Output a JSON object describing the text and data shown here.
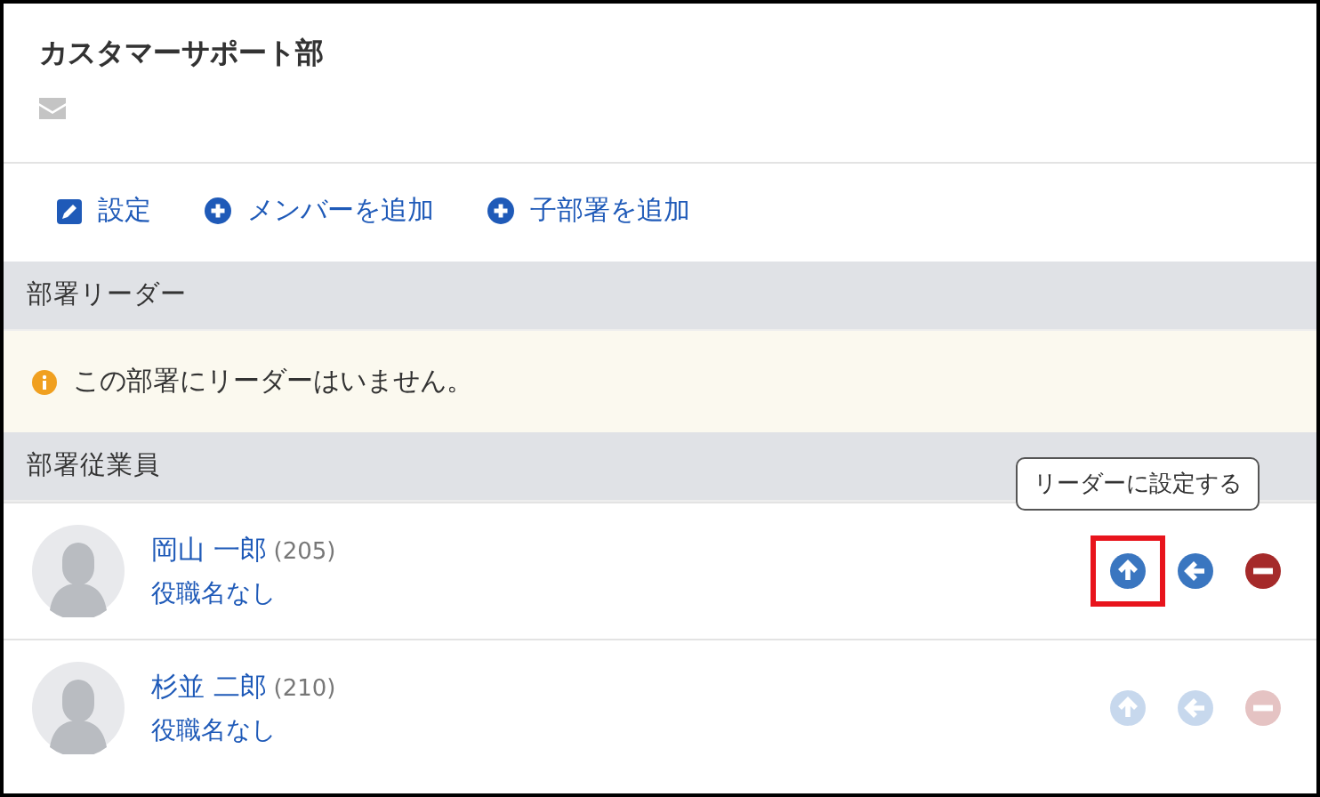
{
  "department": {
    "title": "カスタマーサポート部"
  },
  "toolbar": [
    {
      "kind": "edit",
      "label": "設定"
    },
    {
      "kind": "add",
      "label": "メンバーを追加"
    },
    {
      "kind": "add",
      "label": "子部署を追加"
    }
  ],
  "leader_section": {
    "heading": "部署リーダー",
    "notice": "この部署にリーダーはいません。"
  },
  "members_section": {
    "heading": "部署従業員",
    "members": [
      {
        "name": "岡山 一郎",
        "number": "(205)",
        "position": "役職名なし",
        "active": true,
        "tooltip": "リーダーに設定する",
        "actions": [
          {
            "kind": "promote",
            "highlighted": true
          },
          {
            "kind": "move",
            "highlighted": false
          },
          {
            "kind": "remove",
            "highlighted": false
          }
        ]
      },
      {
        "name": "杉並 二郎",
        "number": "(210)",
        "position": "役職名なし",
        "active": false,
        "actions": [
          {
            "kind": "promote",
            "highlighted": false
          },
          {
            "kind": "move",
            "highlighted": false
          },
          {
            "kind": "remove",
            "highlighted": false
          }
        ]
      }
    ]
  }
}
